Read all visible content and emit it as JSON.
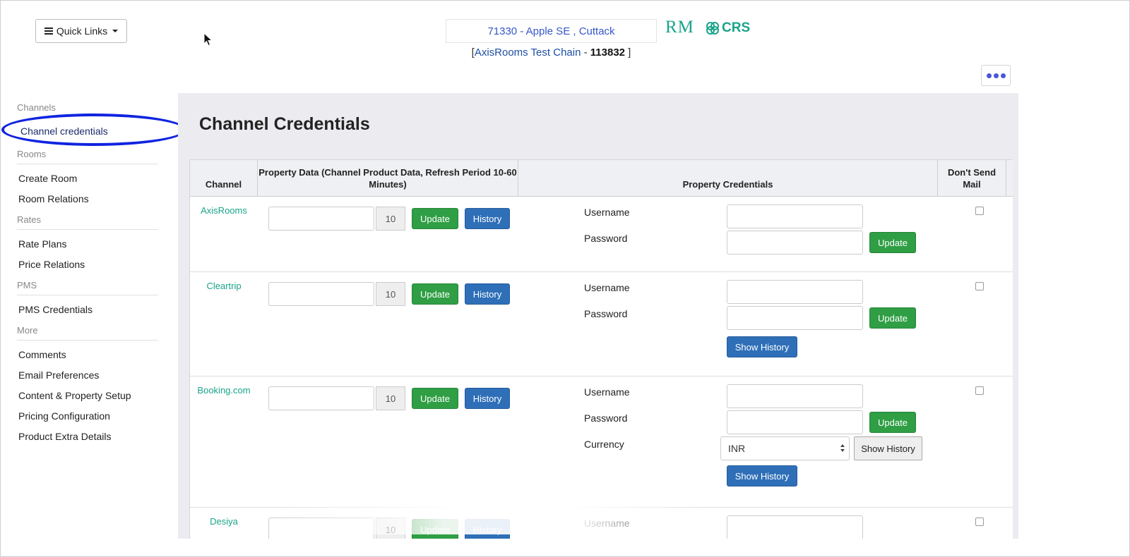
{
  "header": {
    "quick_links_label": "Quick Links",
    "hotel_selector": "71330 - Apple SE , Cuttack",
    "chain_open": "[",
    "chain_name": "AxisRooms Test Chain",
    "chain_sep": " - ",
    "chain_id": "113832",
    "chain_close": " ]",
    "rm_logo": "RM",
    "crs_logo": "CRS"
  },
  "sidebar": {
    "channels_heading": "Channels",
    "channel_credentials": "Channel credentials",
    "rooms_heading": "Rooms",
    "create_room": "Create Room",
    "room_relations": "Room Relations",
    "rates_heading": "Rates",
    "rate_plans": "Rate Plans",
    "price_relations": "Price Relations",
    "pms_heading": "PMS",
    "pms_credentials": "PMS Credentials",
    "more_heading": "More",
    "comments": "Comments",
    "email_preferences": "Email Preferences",
    "content_property_setup": "Content & Property Setup",
    "pricing_configuration": "Pricing Configuration",
    "product_extra_details": "Product Extra Details"
  },
  "main": {
    "title": "Channel Credentials",
    "columns": {
      "channel": "Channel",
      "property_data": "Property Data (Channel Product Data, Refresh Period 10-60 Minutes)",
      "property_credentials": "Property Credentials",
      "dont_send_mail": "Don't Send Mail"
    },
    "labels": {
      "update": "Update",
      "history": "History",
      "show_history": "Show History",
      "username": "Username",
      "password": "Password",
      "currency": "Currency"
    },
    "rows": [
      {
        "channel": "AxisRooms",
        "period": "10"
      },
      {
        "channel": "Cleartrip",
        "period": "10"
      },
      {
        "channel": "Booking.com",
        "period": "10",
        "currency": "INR"
      },
      {
        "channel": "Desiya",
        "period": "10"
      }
    ]
  },
  "colors": {
    "accent_teal": "#1aa38a",
    "update_green": "#2f9e44",
    "history_blue": "#2e6fb8",
    "highlight_ring": "#1024e0"
  }
}
